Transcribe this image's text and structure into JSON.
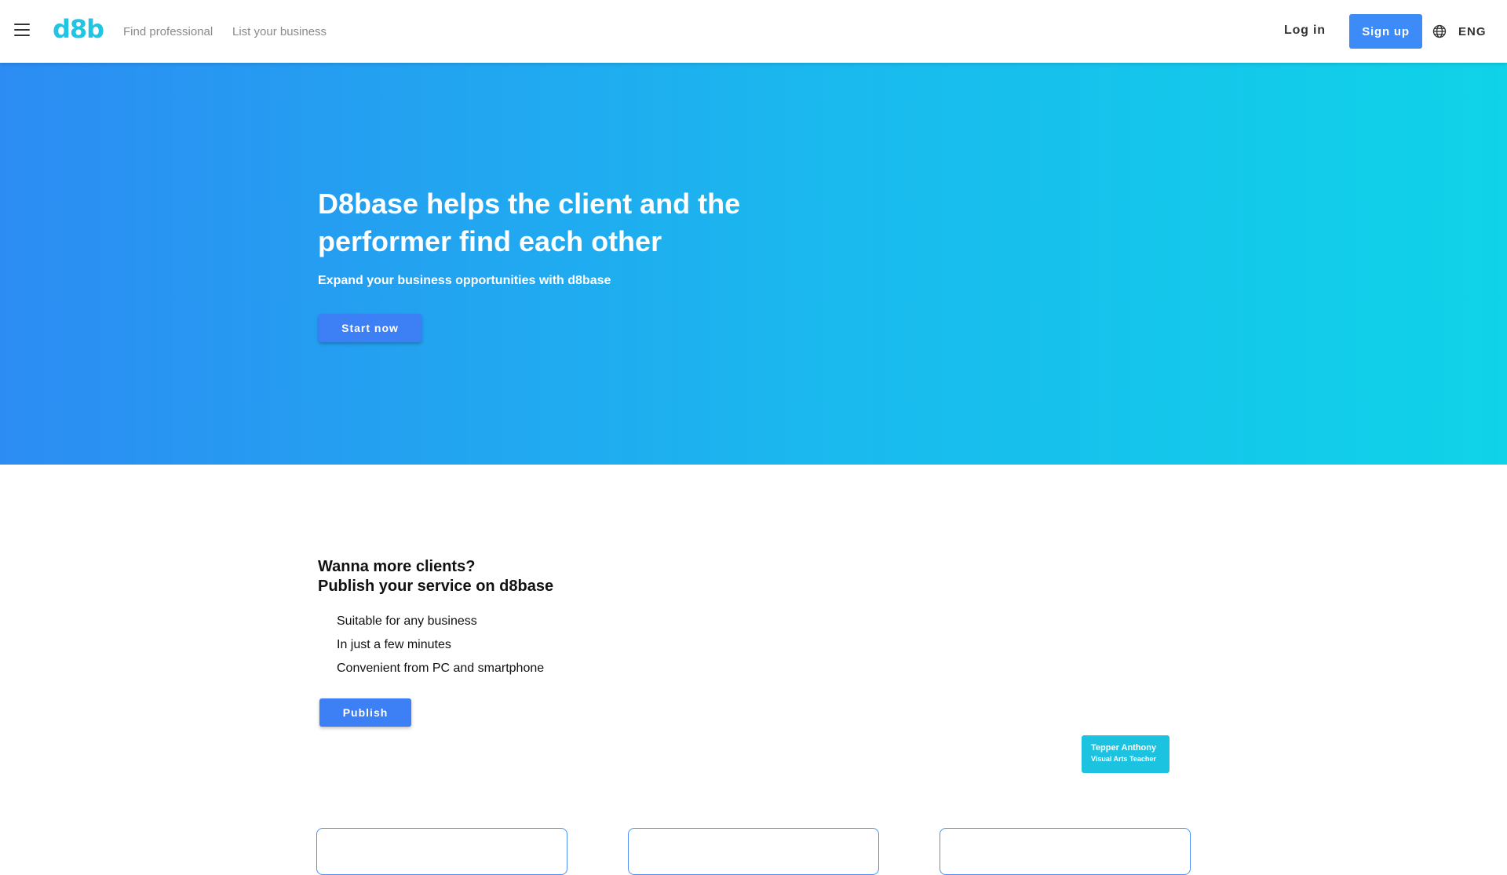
{
  "header": {
    "logo": "d8b",
    "nav": [
      {
        "label": "Find professional"
      },
      {
        "label": "List your business"
      }
    ],
    "login_label": "Log in",
    "signup_label": "Sign up",
    "language": "ENG"
  },
  "hero": {
    "title": "D8base helps the client and the performer find each other",
    "subtitle": "Expand your business opportunities with d8base",
    "cta_label": "Start now",
    "gradient_colors": [
      "#2c8cf3",
      "#1ab9ee",
      "#0fd3e8"
    ]
  },
  "publish": {
    "title_line1": "Wanna more clients?",
    "title_line2": "Publish your service on d8base",
    "features": [
      "Suitable for any business",
      "In just a few minutes",
      "Convenient from PC and smartphone"
    ],
    "button_label": "Publish"
  },
  "badge": {
    "name": "Tepper Anthony",
    "role": "Visual Arts Teacher"
  },
  "colors": {
    "accent": "#3d7ff5",
    "brand": "#21c4e3",
    "card_border": "#4e8ff6"
  }
}
